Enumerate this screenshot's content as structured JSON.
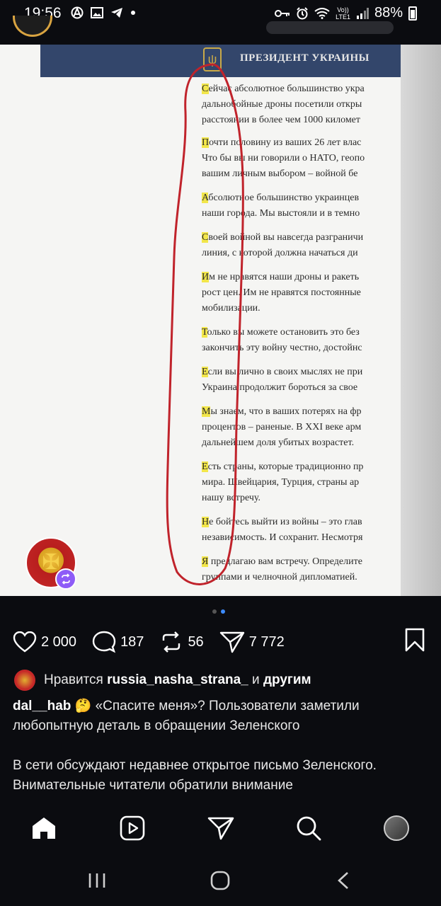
{
  "status_bar": {
    "time": "19:56",
    "battery": "88%",
    "network_top": "Vo))",
    "network_bottom": "LTE1"
  },
  "document": {
    "header_title": "ПРЕЗИДЕНТ УКРАИНЫ",
    "paragraphs": [
      {
        "first": "Сейчас",
        "lines": [
          "Сейчас абсолютное большинство укра",
          "дальнобойные дроны посетили откры",
          "расстоянии в более чем 1000 километ"
        ]
      },
      {
        "first": "Почти",
        "lines": [
          "Почти половину из ваших 26 лет влас",
          "Что бы вы ни говорили о НАТО, геопо",
          "вашим личным выбором – войной бе"
        ]
      },
      {
        "first": "Абсолютное",
        "lines": [
          "Абсолютное большинство украинцев",
          "наши города. Мы выстояли и в темно"
        ]
      },
      {
        "first": "Своей",
        "lines": [
          "Своей войной вы навсегда разграничи",
          "линия, с которой должна начаться ди"
        ]
      },
      {
        "first": "Им",
        "lines": [
          "Им не нравятся наши дроны и ракеть",
          "рост цен. Им не нравятся постоянные",
          "мобилизации."
        ]
      },
      {
        "first": "Только",
        "lines": [
          "Только вы можете остановить это без",
          "закончить эту войну честно, достойнс"
        ]
      },
      {
        "first": "Если",
        "lines": [
          "Если вы лично в своих мыслях не при",
          "Украина продолжит бороться за свое"
        ]
      },
      {
        "first": "Мы",
        "lines": [
          "Мы знаем, что в ваших потерях на фр",
          "процентов – раненые. В XXI веке арм",
          "дальнейшем доля убитых возрастет."
        ]
      },
      {
        "first": "Есть",
        "lines": [
          "Есть страны, которые традиционно пр",
          "мира. Швейцария, Турция, страны ар",
          "нашу встречу."
        ]
      },
      {
        "first": "Не",
        "lines": [
          "Не бойтесь выйти из войны – это глав",
          "независимость. И сохранит. Несмотря"
        ]
      },
      {
        "first": "Я",
        "lines": [
          "Я предлагаю вам встречу. Определите",
          "группами и челночной дипломатией."
        ]
      }
    ]
  },
  "actions": {
    "likes": "2 000",
    "comments": "187",
    "reposts": "56",
    "shares": "7 772"
  },
  "likes_line": {
    "prefix": "Нравится",
    "user": "russia_nasha_strana_",
    "middle": "и",
    "suffix": "другим"
  },
  "caption": {
    "username": "dal__hab",
    "emoji": "🤔",
    "text": "«Спасите меня»? Пользователи заметили любопытную деталь в обращении Зеленского",
    "text2": "В сети обсуждают недавнее открытое письмо Зеленского. Внимательные читатели обратили внимание"
  },
  "icons": {
    "home": "home-icon",
    "reels": "reels-icon",
    "send": "send-icon",
    "search": "search-icon",
    "profile": "profile-avatar"
  },
  "colors": {
    "highlight": "#f2e64a",
    "annotation_red": "#c0232b",
    "doc_header": "#33466b",
    "repost_badge": "#8e5cf7"
  }
}
